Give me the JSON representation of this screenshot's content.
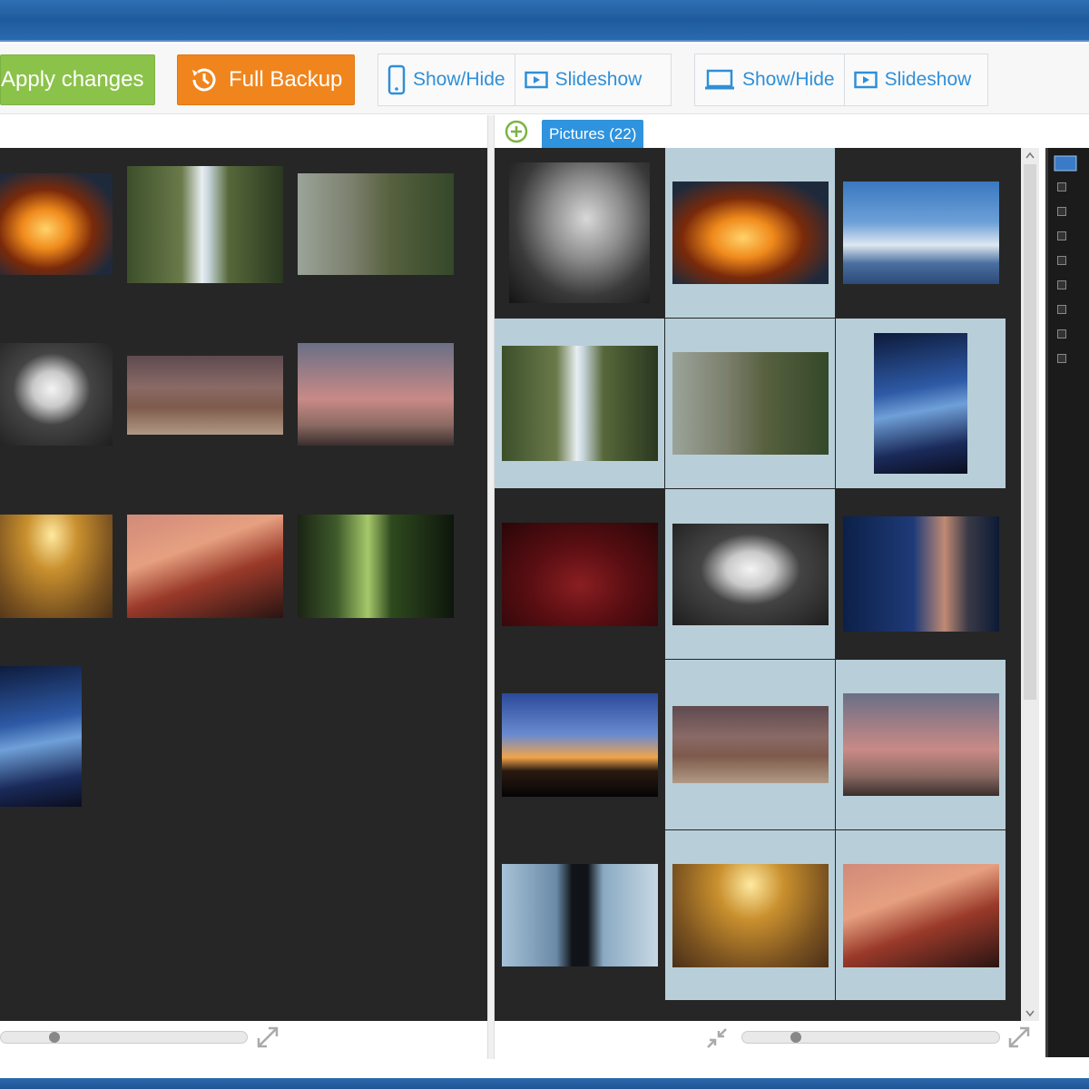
{
  "toolbar": {
    "apply_label": "Apply changes",
    "backup_label": "Full Backup",
    "group_phone": {
      "showhide": "Show/Hide",
      "slideshow": "Slideshow"
    },
    "group_desktop": {
      "showhide": "Show/Hide",
      "slideshow": "Slideshow"
    }
  },
  "right": {
    "tab_label": "Pictures (22)"
  },
  "colors": {
    "apply": "#8bc34a",
    "backup": "#f0851d",
    "accent": "#2f93de",
    "selected_cell": "#b8cfd9",
    "panel_bg": "#262626"
  },
  "left_thumbs": [
    {
      "name": "fire"
    },
    {
      "name": "waterfall"
    },
    {
      "name": "deer-stream"
    },
    {
      "name": "train-window"
    },
    {
      "name": "deer-field"
    },
    {
      "name": "hiker-sunset"
    },
    {
      "name": "autumn-leaves"
    },
    {
      "name": "lava-sunset"
    },
    {
      "name": "forest"
    },
    {
      "name": "night-sky"
    }
  ],
  "right_thumbs": [
    {
      "name": "storm-clouds",
      "selected": false
    },
    {
      "name": "fire",
      "selected": true
    },
    {
      "name": "wave",
      "selected": false
    },
    {
      "name": "waterfall",
      "selected": true
    },
    {
      "name": "deer-stream",
      "selected": true
    },
    {
      "name": "night-sky",
      "selected": true
    },
    {
      "name": "red-crowd",
      "selected": false
    },
    {
      "name": "train-window",
      "selected": true
    },
    {
      "name": "singer",
      "selected": false
    },
    {
      "name": "silhouette-horizon",
      "selected": false
    },
    {
      "name": "deer-field",
      "selected": true
    },
    {
      "name": "hiker-sunset",
      "selected": true
    },
    {
      "name": "man-lake",
      "selected": false
    },
    {
      "name": "autumn-leaves",
      "selected": true
    },
    {
      "name": "lava-sunset",
      "selected": true
    }
  ]
}
